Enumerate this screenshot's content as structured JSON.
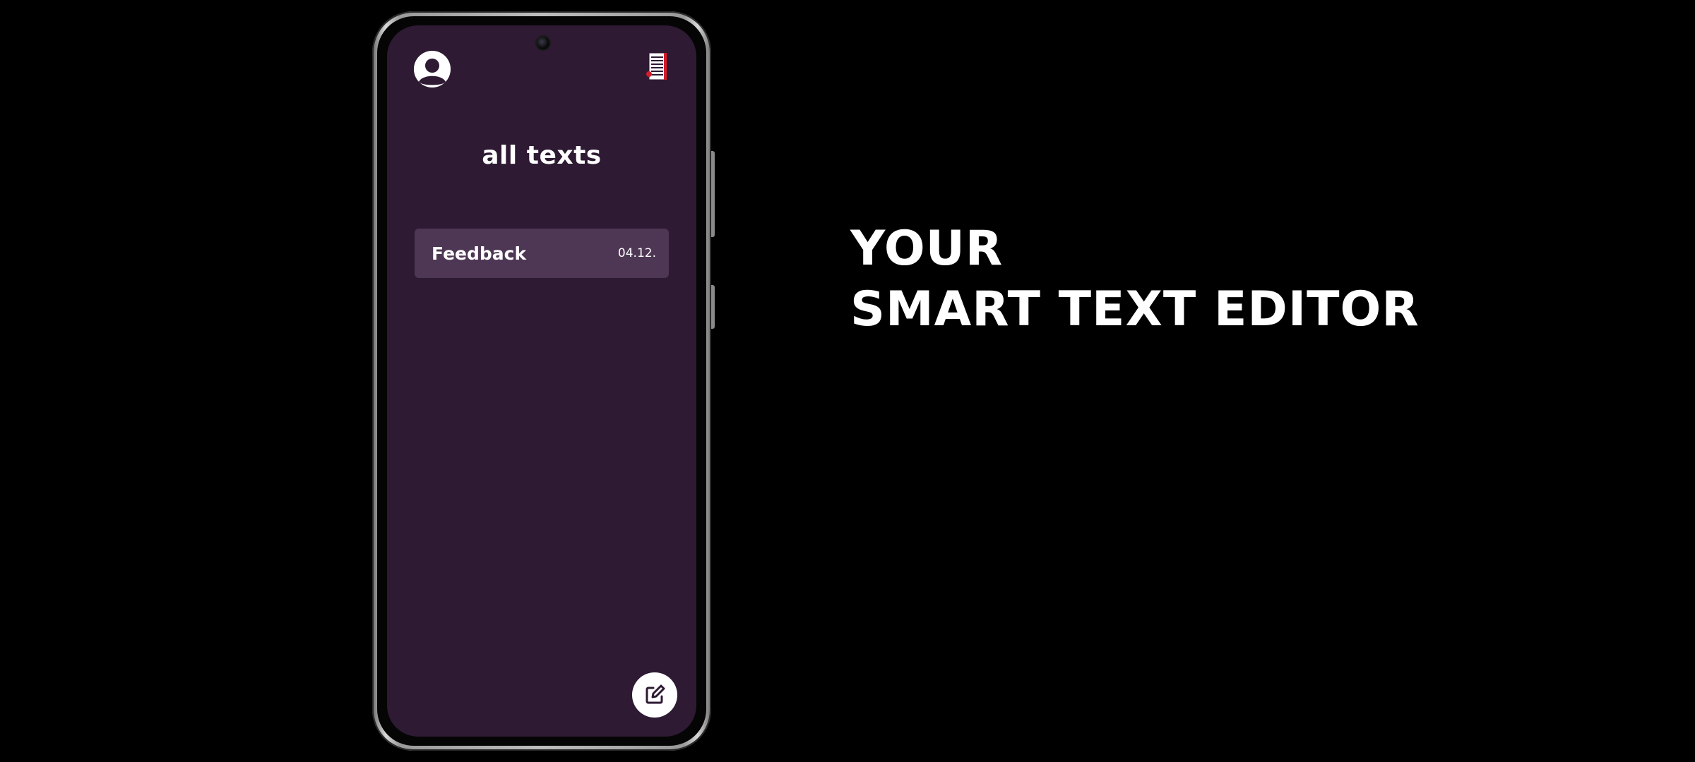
{
  "app": {
    "screen_title": "all texts",
    "texts": [
      {
        "title": "Feedback",
        "date": "04.12."
      }
    ],
    "icons": {
      "profile": "user-circle-icon",
      "documents": "document-list-icon",
      "new_text": "edit-icon"
    },
    "colors": {
      "screen_background": "#2e1a33",
      "list_item_background": "#4e3754",
      "accent_red": "#d41c2c"
    }
  },
  "promo": {
    "headline_line1": "YOUR",
    "headline_line2": "SMART TEXT EDITOR"
  }
}
